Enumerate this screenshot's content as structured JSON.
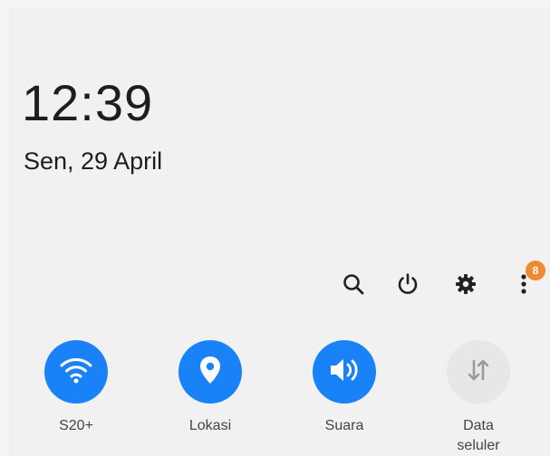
{
  "clock": {
    "time": "12:39",
    "date": "Sen, 29 April"
  },
  "actions": {
    "search_icon": "search-icon",
    "power_icon": "power-icon",
    "settings_icon": "gear-icon",
    "more_icon": "more-vertical-icon",
    "notification_badge": "8",
    "badge_color": "#f08a30"
  },
  "tiles": [
    {
      "label": "S20+",
      "icon": "wifi-icon",
      "state": "on"
    },
    {
      "label": "Lokasi",
      "icon": "location-pin-icon",
      "state": "on"
    },
    {
      "label": "Suara",
      "icon": "volume-icon",
      "state": "on"
    },
    {
      "label_line1": "Data",
      "label_line2": "seluler",
      "icon": "data-transfer-icon",
      "state": "off"
    }
  ],
  "colors": {
    "accent": "#1a82f7",
    "tile_off": "#e7e7e7",
    "background": "#f1f1f1"
  }
}
